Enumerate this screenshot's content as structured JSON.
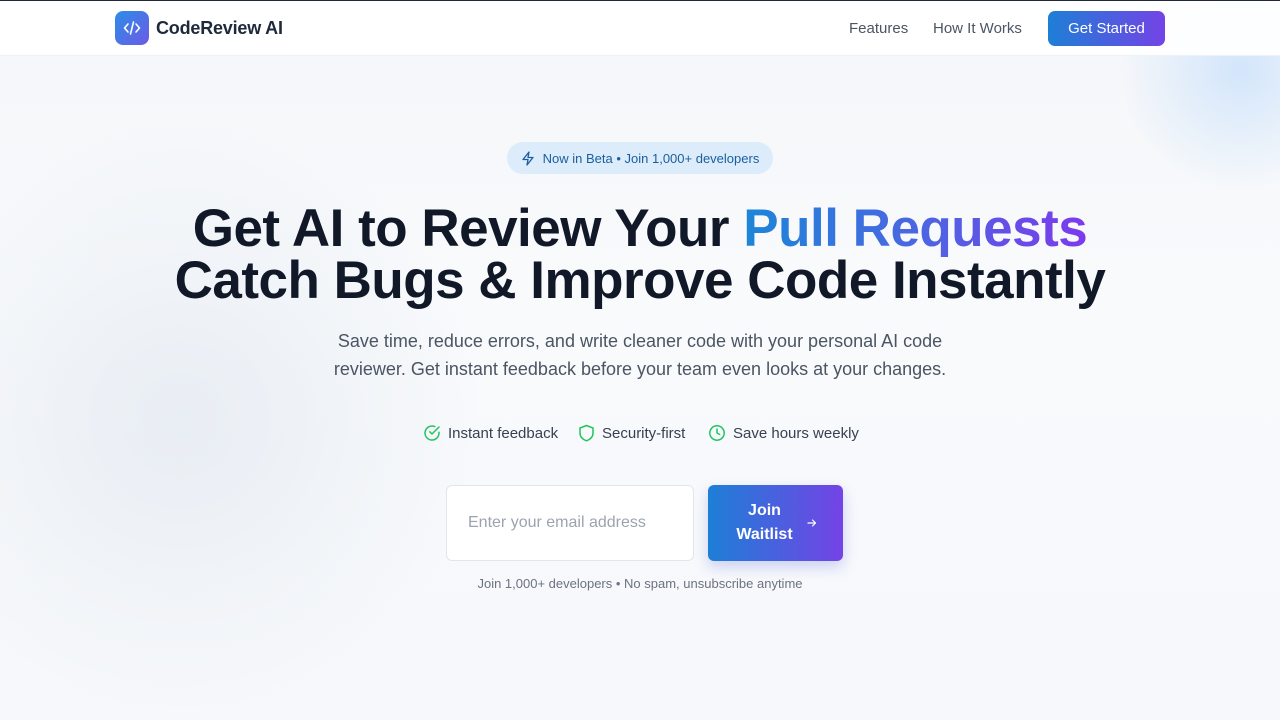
{
  "brand": {
    "name": "CodeReview AI",
    "gradient_start": "#2b8de8",
    "gradient_end": "#6d5ae6"
  },
  "nav": {
    "links": [
      "Features",
      "How It Works"
    ],
    "cta_label": "Get Started"
  },
  "hero": {
    "badge": "Now in Beta • Join 1,000+ developers",
    "title_line1_prefix": "Get AI to Review Your ",
    "title_line1_highlight": "Pull Requests",
    "title_line2": "Catch Bugs & Improve Code Instantly",
    "subtitle": "Save time, reduce errors, and write cleaner code with your personal AI code reviewer. Get instant feedback before your team even looks at your changes."
  },
  "features": [
    {
      "label": "Instant feedback",
      "icon": "check-circle-icon"
    },
    {
      "label": "Security-first",
      "icon": "shield-icon"
    },
    {
      "label": "Save hours weekly",
      "icon": "clock-icon"
    }
  ],
  "signup": {
    "email_placeholder": "Enter your email address",
    "button_label": "Join Waitlist",
    "note": "Join 1,000+ developers • No spam, unsubscribe anytime"
  },
  "colors": {
    "accent_blue": "#1d7fd6",
    "accent_purple": "#7443e6",
    "feature_green": "#22c55e",
    "badge_bg": "#dcecfb",
    "badge_text": "#1b5e9e"
  }
}
